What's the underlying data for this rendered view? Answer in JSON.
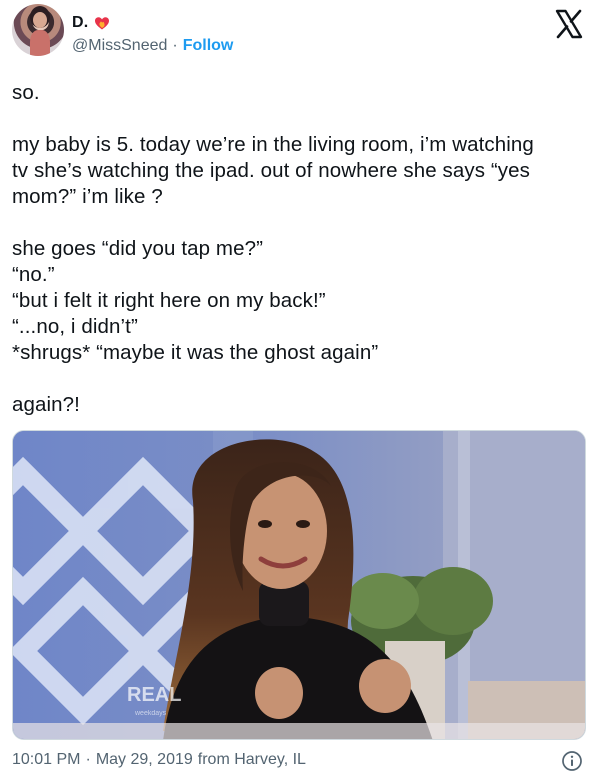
{
  "user": {
    "display_name": "D.",
    "handle": "@MissSneed",
    "separator": "·",
    "follow_label": "Follow",
    "verified_emoji": "heart-on-fire"
  },
  "icons": {
    "platform": "x-logo-icon",
    "info": "info-icon",
    "badge": "flaming-heart-icon"
  },
  "tweet": {
    "paragraphs": [
      [
        "so."
      ],
      [
        "my baby is 5. today we’re in the living room, i’m watching",
        "tv she’s watching the ipad. out of nowhere she says “yes",
        "mom?” i’m like ?"
      ],
      [
        "she goes “did you tap me?”",
        "“no.”",
        "“but i felt it right here on my back!”",
        "“...no, i didn’t”",
        "*shrugs* “maybe it was the ghost again”"
      ],
      [
        "again?!"
      ]
    ]
  },
  "media": {
    "watermark": "REAL",
    "sub_watermark": "weekdays"
  },
  "footer": {
    "time": "10:01 PM",
    "separator": "·",
    "date": "May 29, 2019",
    "source": "from Harvey, IL"
  },
  "colors": {
    "link": "#1d9bf0",
    "secondary_text": "#536471",
    "primary_text": "#0f1419"
  }
}
